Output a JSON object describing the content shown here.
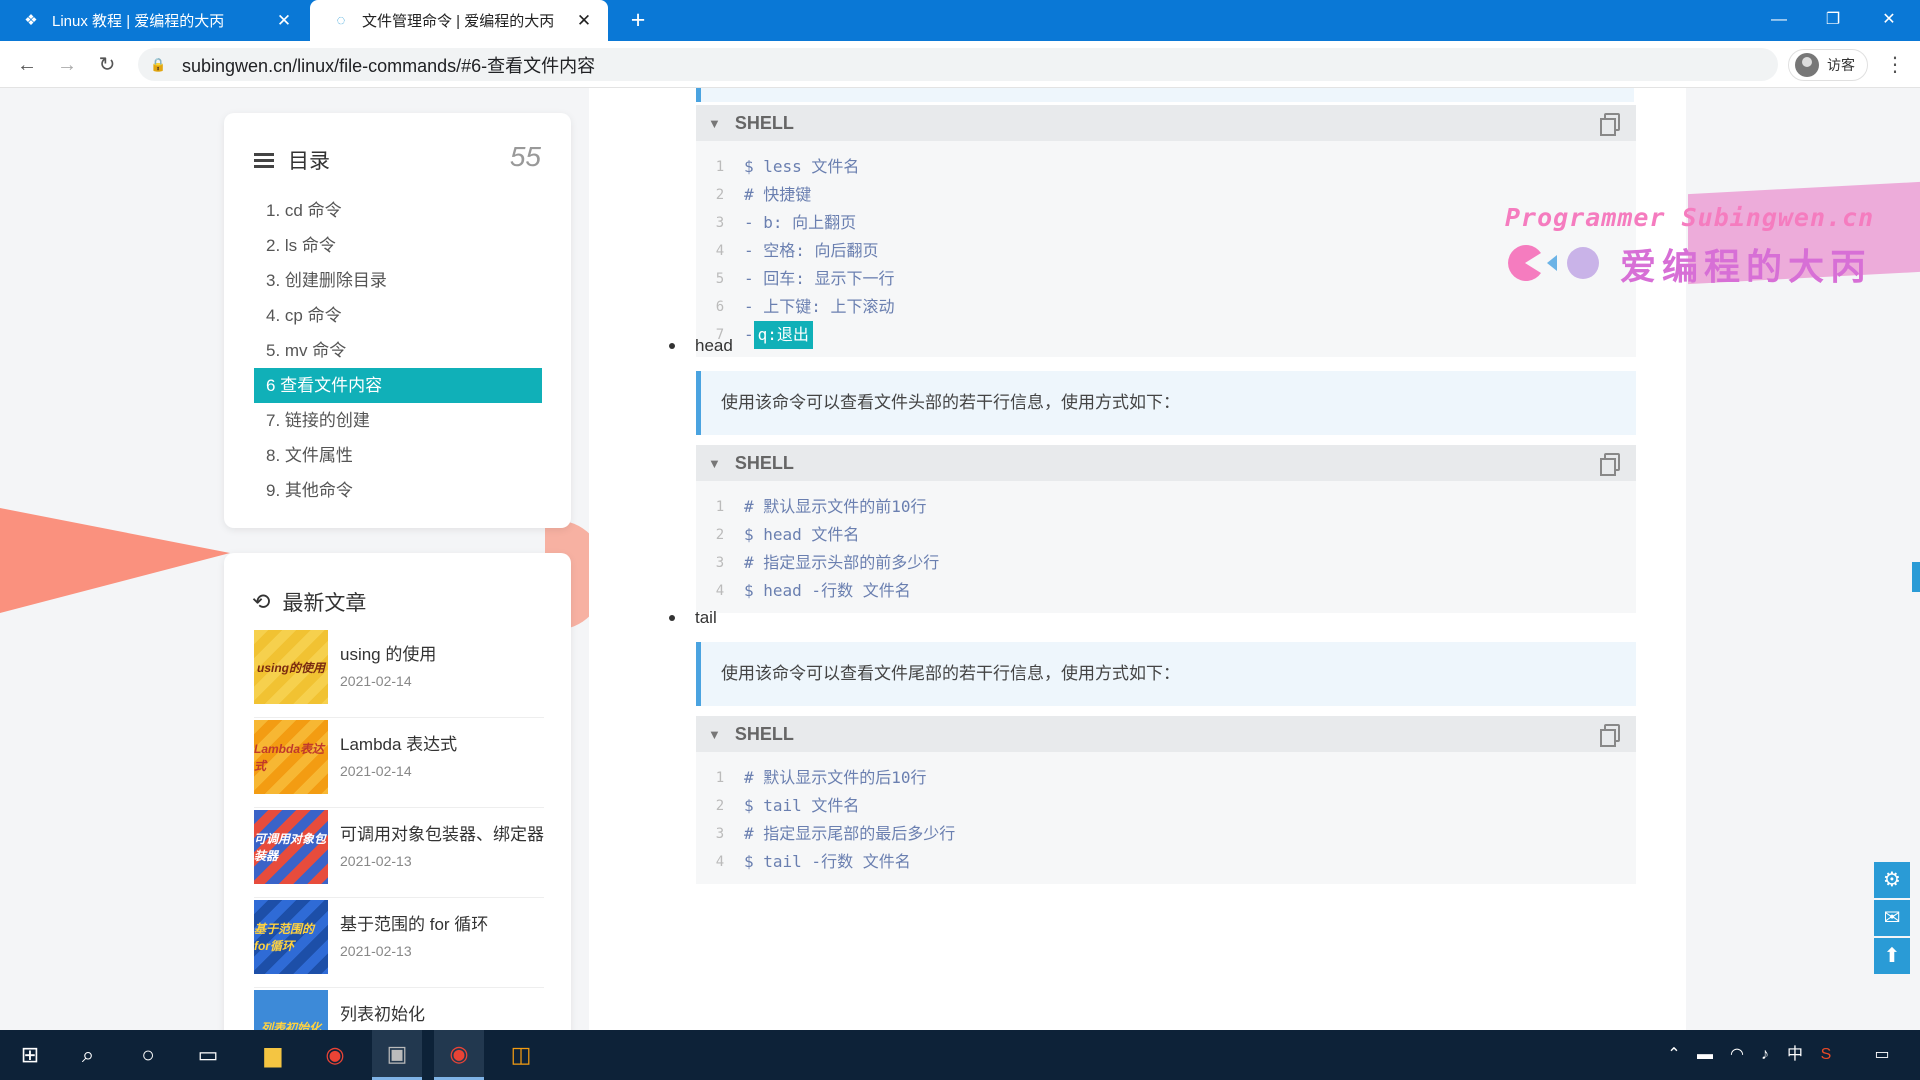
{
  "browser": {
    "tabs": [
      {
        "title": "Linux 教程 | 爱编程的大丙",
        "active": false
      },
      {
        "title": "文件管理命令 | 爱编程的大丙",
        "active": true
      }
    ],
    "new_tab": "+",
    "url": "subingwen.cn/linux/file-commands/#6-查看文件内容",
    "profile_label": "访客"
  },
  "sidebar": {
    "toc": {
      "title": "目录",
      "count": "55",
      "items": [
        {
          "label": "1. cd 命令",
          "active": false
        },
        {
          "label": "2. ls 命令",
          "active": false
        },
        {
          "label": "3. 创建删除目录",
          "active": false
        },
        {
          "label": "4. cp 命令",
          "active": false
        },
        {
          "label": "5. mv 命令",
          "active": false
        },
        {
          "label": "6 查看文件内容",
          "active": true
        },
        {
          "label": "7. 链接的创建",
          "active": false
        },
        {
          "label": "8. 文件属性",
          "active": false
        },
        {
          "label": "9. 其他命令",
          "active": false
        }
      ]
    },
    "recent": {
      "title": "最新文章",
      "posts": [
        {
          "title": "using 的使用",
          "date": "2021-02-14",
          "thumb_text": "using的使用",
          "thumb_color": "#f1c232"
        },
        {
          "title": "Lambda 表达式",
          "date": "2021-02-14",
          "thumb_text": "Lambda表达式",
          "thumb_color": "#f39c12"
        },
        {
          "title": "可调用对象包装器、绑定器",
          "date": "2021-02-13",
          "thumb_text": "可调用对象包装器",
          "thumb_color": "#e74c3c"
        },
        {
          "title": "基于范围的 for 循环",
          "date": "2021-02-13",
          "thumb_text": "基于范围的for循环",
          "thumb_color": "#2f6bd6"
        },
        {
          "title": "列表初始化",
          "date": "",
          "thumb_text": "列表初始化",
          "thumb_color": "#3d8ad8"
        }
      ]
    }
  },
  "article": {
    "code_blocks": [
      {
        "lang": "SHELL",
        "lines": [
          {
            "n": "1",
            "text": "$ less 文件名"
          },
          {
            "n": "2",
            "text": "# 快捷键"
          },
          {
            "n": "3",
            "text": "- b: 向上翻页"
          },
          {
            "n": "4",
            "text": "- 空格: 向后翻页"
          },
          {
            "n": "5",
            "text": "- 回车: 显示下一行"
          },
          {
            "n": "6",
            "text": "- 上下键: 上下滚动"
          },
          {
            "n": "7",
            "text": "- ",
            "highlight": "q:退出"
          }
        ]
      },
      {
        "lang": "SHELL",
        "lines": [
          {
            "n": "1",
            "text": "# 默认显示文件的前10行"
          },
          {
            "n": "2",
            "text": "$ head 文件名"
          },
          {
            "n": "3",
            "text": "# 指定显示头部的前多少行"
          },
          {
            "n": "4",
            "text": "$ head -行数 文件名"
          }
        ]
      },
      {
        "lang": "SHELL",
        "lines": [
          {
            "n": "1",
            "text": "# 默认显示文件的后10行"
          },
          {
            "n": "2",
            "text": "$ tail 文件名"
          },
          {
            "n": "3",
            "text": "# 指定显示尾部的最后多少行"
          },
          {
            "n": "4",
            "text": "$ tail -行数 文件名"
          }
        ]
      }
    ],
    "bullets": [
      "head",
      "tail"
    ],
    "notes": [
      "使用该命令可以查看文件头部的若干行信息，使用方式如下：",
      "使用该命令可以查看文件尾部的若干行信息，使用方式如下："
    ]
  },
  "watermark": {
    "line1": "Programmer Subingwen.cn",
    "line2": "爱编程的大丙"
  },
  "colors": {
    "accent": "#10b0b8",
    "brand_blue": "#0a78d6",
    "quote_border": "#4aa3e0"
  },
  "taskbar": {
    "ime": "中"
  }
}
